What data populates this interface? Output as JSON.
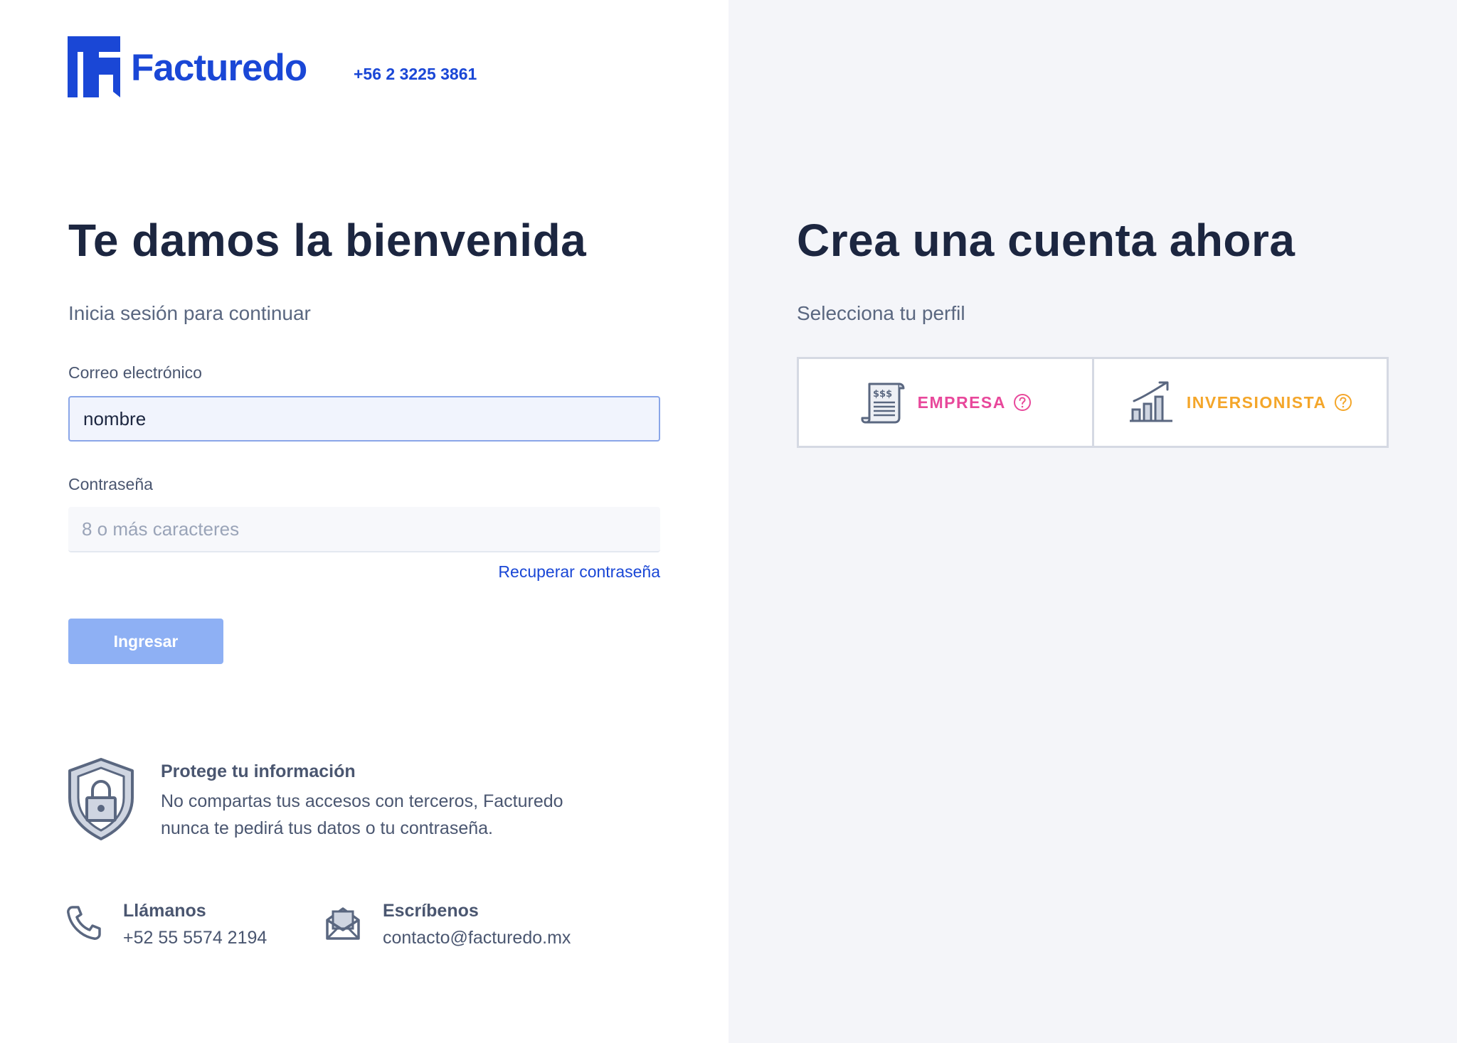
{
  "brand": {
    "name": "Facturedo",
    "phone": "+56 2 3225 3861"
  },
  "login": {
    "title": "Te damos la bienvenida",
    "subtitle": "Inicia sesión para continuar",
    "email_label": "Correo electrónico",
    "email_value": "nombre",
    "password_label": "Contraseña",
    "password_placeholder": "8 o más caracteres",
    "recover_link": "Recuperar contraseña",
    "submit_label": "Ingresar"
  },
  "security_tip": {
    "title": "Protege tu información",
    "body": "No compartas tus accesos con terceros, Facturedo nunca te pedirá tus datos o tu contraseña."
  },
  "contact": {
    "call_title": "Llámanos",
    "call_value": "+52 55 5574 2194",
    "write_title": "Escríbenos",
    "write_value": "contacto@facturedo.mx"
  },
  "signup": {
    "title": "Crea una cuenta ahora",
    "subtitle": "Selecciona tu perfil",
    "profiles": [
      {
        "label": "EMPRESA",
        "icon": "receipt-icon",
        "color": "#e8489b"
      },
      {
        "label": "INVERSIONISTA",
        "icon": "growth-chart-icon",
        "color": "#f4a62a"
      }
    ]
  },
  "colors": {
    "brand_blue": "#1a47d6",
    "button_disabled": "#8eb0f4",
    "text_dark": "#1c2640",
    "text_muted": "#4a5670",
    "right_panel_bg": "#f4f5f9"
  }
}
